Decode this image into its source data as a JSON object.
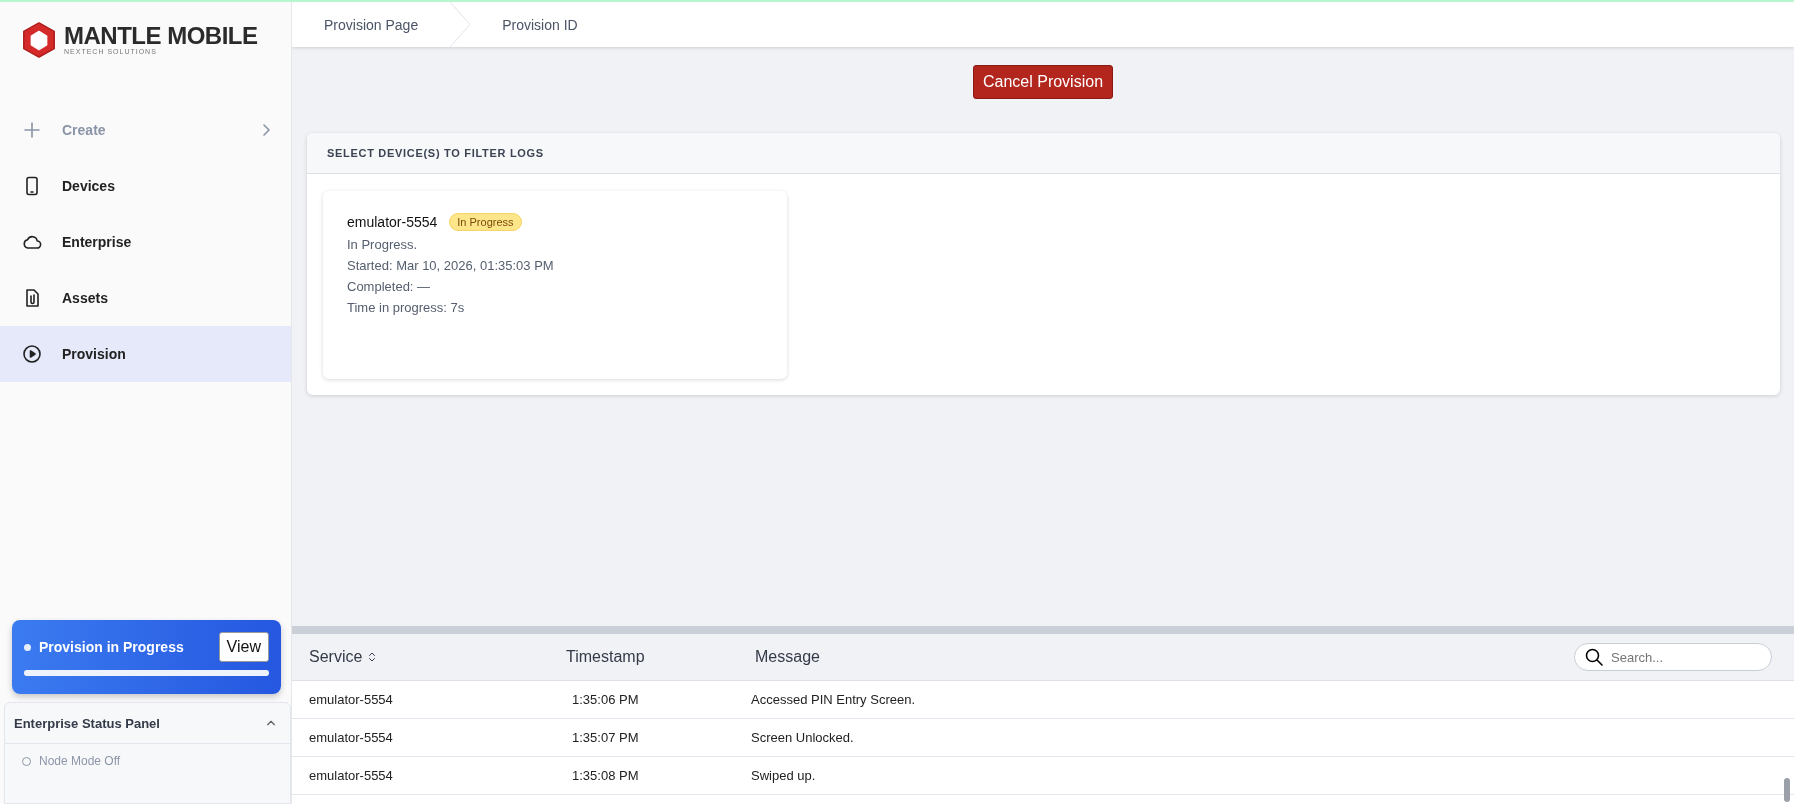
{
  "brand": {
    "name": "MANTLE MOBILE",
    "tagline": "NEXTECH SOLUTIONS"
  },
  "sidebar": {
    "items": [
      {
        "label": "Create",
        "selected": false,
        "disabled": true,
        "kind": "submenu"
      },
      {
        "label": "Devices",
        "selected": false,
        "disabled": false,
        "kind": "link"
      },
      {
        "label": "Enterprise",
        "selected": false,
        "disabled": false,
        "kind": "link"
      },
      {
        "label": "Assets",
        "selected": false,
        "disabled": false,
        "kind": "link"
      },
      {
        "label": "Provision",
        "selected": true,
        "disabled": false,
        "kind": "link"
      }
    ]
  },
  "provision_status": {
    "label": "Provision in Progress",
    "button": "View",
    "level": 1
  },
  "status_panel": {
    "title": "Enterprise Status Panel",
    "expanded": true,
    "items": [
      {
        "label": "Node Mode Off",
        "on": false
      }
    ]
  },
  "breadcrumbs": [
    "Provision Page",
    "Provision ID"
  ],
  "cancel_button": "Cancel Provision",
  "filter_panel": {
    "title": "SELECT DEVICE(S) TO FILTER LOGS",
    "devices": [
      {
        "name": "emulator-5554",
        "badge": "In Progress",
        "status": "In Progress.",
        "started": "Started: Mar 10, 2026, 01:35:03 PM",
        "completed": "Completed: —",
        "elapsed": "Time in progress: 7s"
      }
    ]
  },
  "log_table": {
    "columns": [
      {
        "label": "Service",
        "sortable": true
      },
      {
        "label": "Timestamp",
        "sortable": false
      },
      {
        "label": "Message",
        "sortable": false
      }
    ],
    "search": {
      "placeholder": "Search..."
    },
    "rows": [
      [
        "emulator-5554",
        "1:35:06 PM",
        "Accessed PIN Entry Screen."
      ],
      [
        "emulator-5554",
        "1:35:07 PM",
        "Screen Unlocked."
      ],
      [
        "emulator-5554",
        "1:35:08 PM",
        "Swiped up."
      ]
    ]
  }
}
